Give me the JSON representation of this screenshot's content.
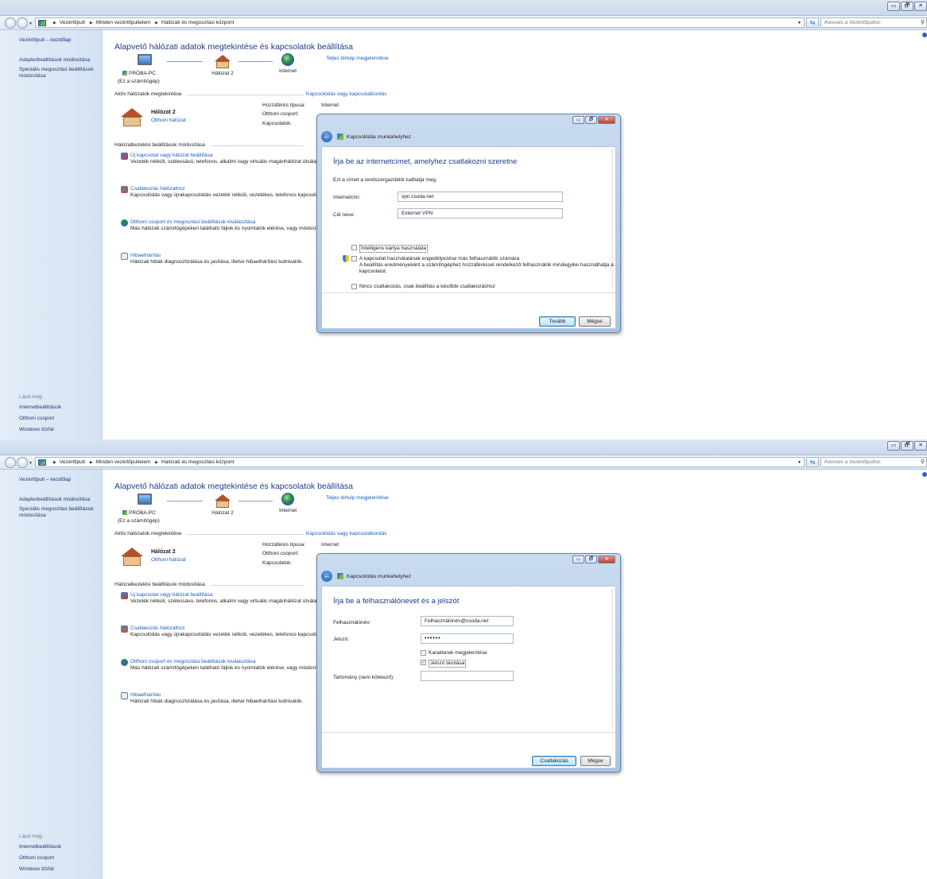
{
  "window": {
    "min": "▭",
    "max": "🗗",
    "close": "✕"
  },
  "nav": {
    "crumbs": [
      "Vezérlőpult",
      "Minden vezérlőpultelem",
      "Hálózati és megosztási központ"
    ],
    "search_placeholder": "Keresés a Vezérlőpulton"
  },
  "sidebar": {
    "home": "Vezérlőpult – kezdőlap",
    "adapter": "Adapterbeállítások módosítása",
    "advanced": "Speciális megosztási beállítások módosítása",
    "see_also": "Lásd még:",
    "internet_options": "Internetbeállítások",
    "homegroup": "Otthoni csoport",
    "firewall": "Windows tűzfal"
  },
  "main": {
    "title": "Alapvető hálózati adatok megtekintése és kapcsolatok beállítása",
    "map_link": "Teljes térkép megjelenítése",
    "pc_name": "PRÓBA-PC",
    "pc_sub": "(Ez a számítógép)",
    "network_node": "Hálózat 2",
    "internet_node": "Internet",
    "active_header": "Aktív hálózatok megtekintése",
    "connect_link": "Kapcsolódás vagy kapcsolatbontás",
    "net_name": "Hálózat 2",
    "net_type": "Otthoni hálózat",
    "access_label": "Hozzáférés típusa:",
    "access_value": "Internet",
    "homegroup_label": "Otthoni csoport:",
    "connections_label": "Kapcsolatok:",
    "settings_header": "Hálózatkezelési beállítások módosítása",
    "tasks": [
      {
        "title": "Új kapcsolat vagy hálózat beállítása",
        "desc": "Vezeték nélküli, szélessávú, telefonos, alkalmi vagy virtuális magánhálózat\nútválasztó vagy hozzáférési pont beállítása."
      },
      {
        "title": "Csatlakozás hálózathoz",
        "desc": "Kapcsolódás vagy újrakapcsolódás vezeték nélküli, vezetékes, telefonos\nkapcsolathoz."
      },
      {
        "title": "Otthoni csoport és megosztási beállítások kiválasztása",
        "desc": "Más hálózati számítógépeken található fájlok és nyomtatók elérése, vagy\nmódosítása."
      },
      {
        "title": "Hibaelhárítás",
        "desc": "Hálózati hibák diagnosztizálása és javítása, illetve hibaelhárítási tudnivalók."
      }
    ]
  },
  "dialog1": {
    "title": "Kapcsolódás munkahelyhez",
    "heading": "Írja be az internetcímet, amelyhez csatlakozni szeretne",
    "hint": "Ezt a címet a rendszergazdától tudhatja meg.",
    "address_label": "Internetcím:",
    "address_value": "vpn.csoda.net",
    "dest_label": "Cél neve:",
    "dest_value": "Externet VPN",
    "smartcard": "Intelligens kártya használata",
    "allow_others": "A kapcsolat használatának engedélyezése más felhasználók számára",
    "allow_others_sub": "A beállítás eredményeként a számítógéphez hozzáféréssel rendelkező felhasználók mindegyike használhatja a kapcsolatot.",
    "no_connect": "Nincs csatlakozás, csak beállítás a későbbi csatlakozáshoz",
    "next": "Tovább",
    "cancel": "Mégse"
  },
  "dialog2": {
    "title": "Kapcsolódás munkahelyhez",
    "heading": "Írja be a felhasználónevet és a jelszót",
    "user_label": "Felhasználónév:",
    "user_value": "Felhasználónév@csoda.net",
    "pass_label": "Jelszó:",
    "pass_value": "••••••",
    "show_chars": "Karakterek megjelenítése",
    "remember": "Jelszó tárolása",
    "domain_label": "Tartomány (nem kötelező):",
    "connect": "Csatlakozás",
    "cancel": "Mégse"
  }
}
